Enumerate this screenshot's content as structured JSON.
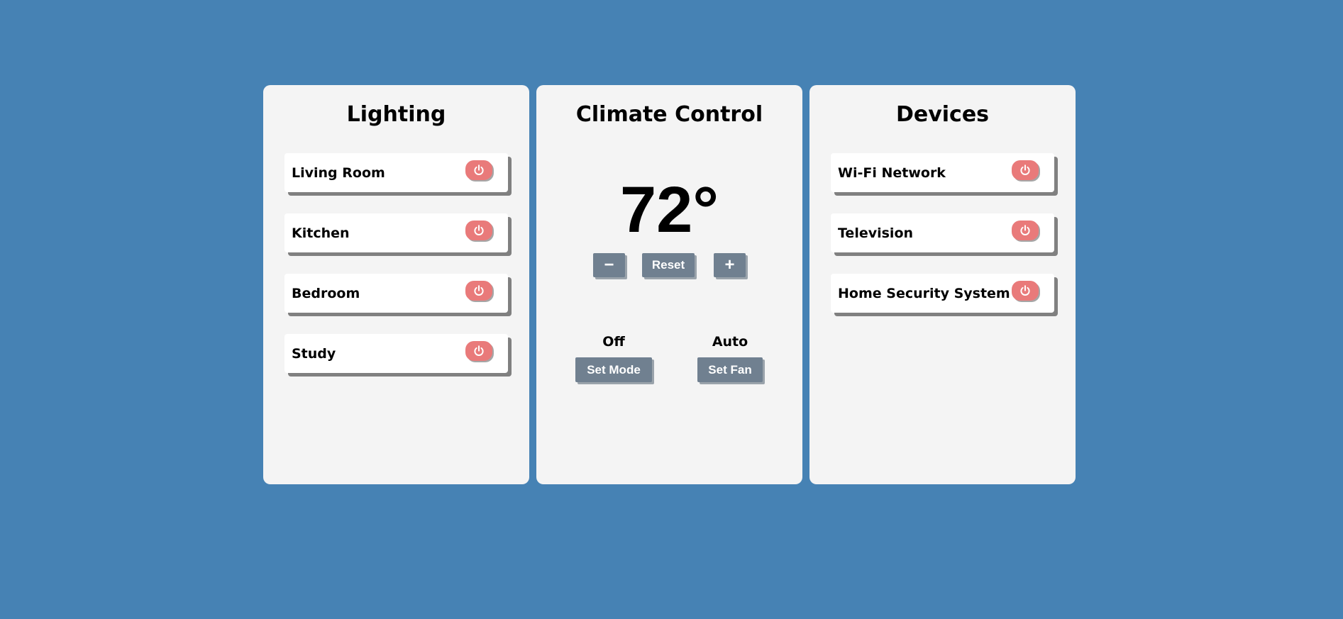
{
  "lighting": {
    "title": "Lighting",
    "items": [
      {
        "label": "Living Room",
        "icon": "power-icon"
      },
      {
        "label": "Kitchen",
        "icon": "power-icon"
      },
      {
        "label": "Bedroom",
        "icon": "power-icon"
      },
      {
        "label": "Study",
        "icon": "power-icon"
      }
    ]
  },
  "climate": {
    "title": "Climate Control",
    "temperature": "72°",
    "decrease_label": "−",
    "reset_label": "Reset",
    "increase_label": "+",
    "mode": {
      "value": "Off",
      "button_label": "Set Mode"
    },
    "fan": {
      "value": "Auto",
      "button_label": "Set Fan"
    }
  },
  "devices": {
    "title": "Devices",
    "items": [
      {
        "label": "Wi-Fi Network",
        "icon": "power-icon"
      },
      {
        "label": "Television",
        "icon": "power-icon"
      },
      {
        "label": "Home Security System",
        "icon": "power-icon"
      }
    ]
  },
  "colors": {
    "background": "#4682b4",
    "panel": "#f4f4f4",
    "toggle_off": "#e97a7a",
    "button": "#708090"
  }
}
